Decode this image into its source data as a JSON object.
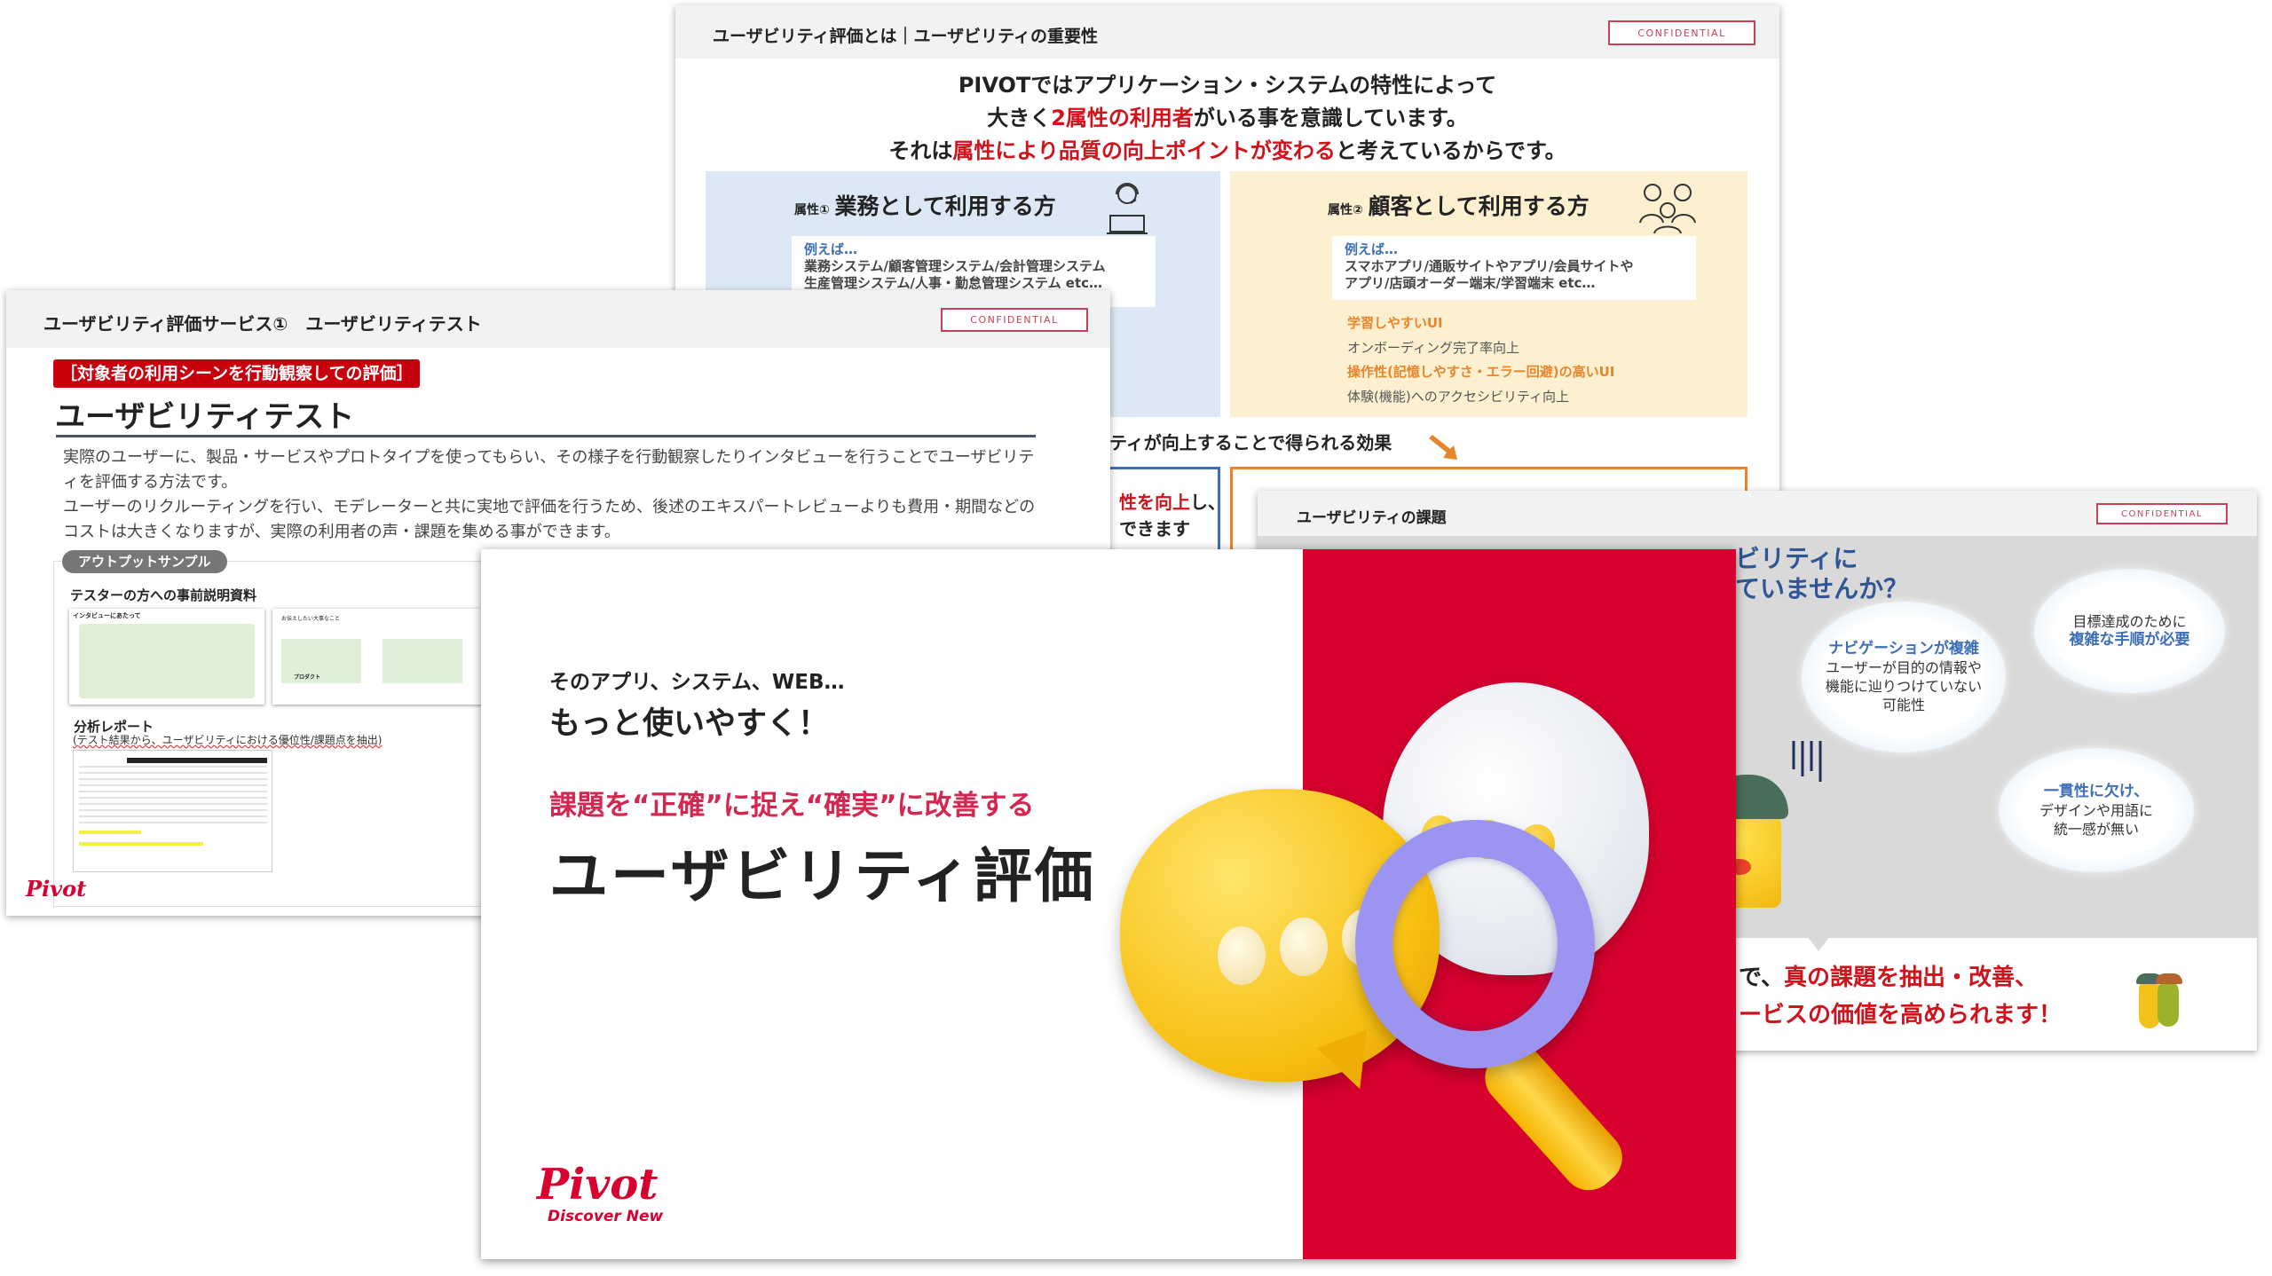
{
  "slide_importance": {
    "header_title": "ユーザビリティ評価とは｜ユーザビリティの重要性",
    "confidential": "CONFIDENTIAL",
    "headline": {
      "line1": "PIVOTではアプリケーション・システムの特性によって",
      "line2_a": "大きく",
      "line2_red": "2属性の利用者",
      "line2_b": "がいる事を意識しています。",
      "line3_a": "それは",
      "line3_red": "属性により品質の向上ポイントが変わる",
      "line3_b": "と考えているからです。"
    },
    "attr1": {
      "prefix": "属性①",
      "title": "業務として利用する方",
      "example_label": "例えば…",
      "example_line1": "業務システム/顧客管理システム/会計管理システム",
      "example_line2": "生産管理システム/人事・勤怠管理システム etc…"
    },
    "attr2": {
      "prefix": "属性②",
      "title": "顧客として利用する方",
      "example_label": "例えば…",
      "example_line1": "スマホアプリ/通販サイトやアプリ/会員サイトや",
      "example_line2": "アプリ/店頭オーダー端末/学習端末 etc…",
      "point1_title": "学習しやすいUI",
      "point1_desc": "オンボーディング完了率向上",
      "point2_title": "操作性(記憶しやすさ・エラー回避)の高いUI",
      "point2_desc": "体験(機能)へのアクセシビリティ向上"
    },
    "effect_heading": "ティが向上することで得られる効果",
    "effect_box_line1_red": "性を向上",
    "effect_box_line1_b": "し、",
    "effect_box_line2": "できます"
  },
  "slide_test": {
    "header_title": "ユーザビリティ評価サービス①　ユーザビリティテスト",
    "confidential": "CONFIDENTIAL",
    "tag": "［対象者の利用シーンを行動観察しての評価］",
    "title": "ユーザビリティテスト",
    "para1": "実際のユーザーに、製品・サービスやプロトタイプを使ってもらい、その様子を行動観察したりインタビューを行うことでユーザビリティを評価する方法です。",
    "para2": "ユーザーのリクルーティングを行い、モデレーターと共に実地で評価を行うため、後述のエキスパートレビューよりも費用・期間などのコストは大きくなりますが、実際の利用者の声・課題を集める事ができます。",
    "output_badge": "アウトプットサンプル",
    "sample1_title": "テスターの方への事前説明資料",
    "thumb1_title": "インタビューにあたって",
    "thumb2_title": "お伝えしたい大事なこと",
    "thumb2_label_product": "プロダクト",
    "report_title": "分析レポート",
    "report_sub": "(テスト結果から、ユーザビリティにおける優位性/課題点を抽出)",
    "logo": "Pivot"
  },
  "slide_issues": {
    "header_title": "ユーザビリティの課題",
    "confidential": "CONFIDENTIAL",
    "question_line1": "ビリティに",
    "question_line2": "ていませんか？",
    "cloud1_line1": "目標達成のために",
    "cloud1_line2": "複雑な手順が必要",
    "cloud2_title": "ナビゲーションが複雑",
    "cloud2_line1": "ユーザーが目的の情報や",
    "cloud2_line2": "機能に辿りつけていない",
    "cloud2_line3": "可能性",
    "cloud3_title": "一貫性に欠け、",
    "cloud3_line1": "デザインや用語に",
    "cloud3_line2": "統一感が無い",
    "bottom_line1_a": "で、",
    "bottom_line1_red": "真の課題を抽出・改善、",
    "bottom_line2_red": "ービスの価値を高められます！"
  },
  "slide_cover": {
    "lead1": "そのアプリ、システム、WEB…",
    "lead2": "もっと使いやすく！",
    "subtitle": "課題を“正確”に捉え“確実”に改善する",
    "title": "ユーザビリティ評価",
    "logo": "Pivot",
    "logo_tagline": "Discover New"
  },
  "colors": {
    "brand_red": "#d7002f",
    "accent_red": "#d0121b",
    "attr1_panel": "#dce8f5",
    "attr2_panel": "#fdf0d0",
    "orange": "#e8852a",
    "blue_text": "#3d6fb6"
  }
}
